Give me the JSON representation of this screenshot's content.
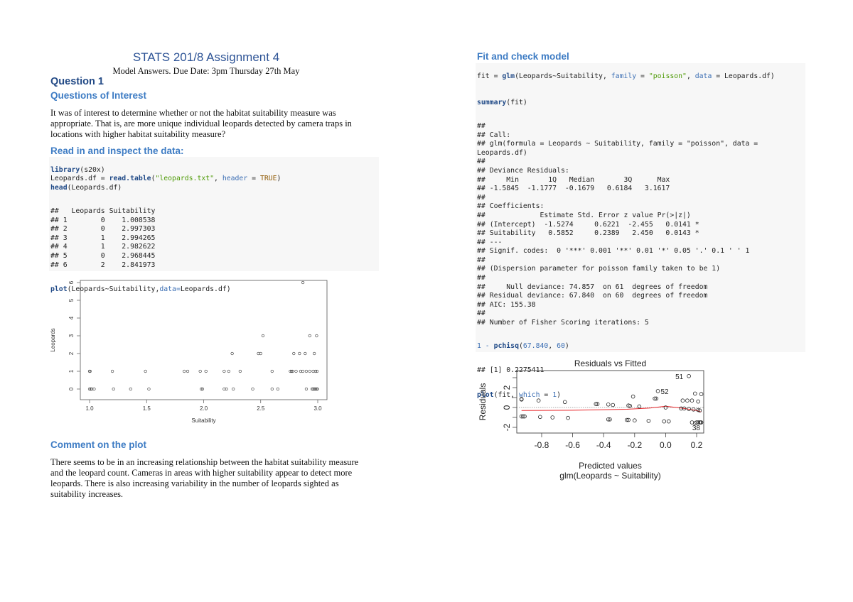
{
  "left": {
    "title": "STATS 201/8 Assignment 4",
    "subtitle": "Model Answers. Due Date: 3pm Thursday 27th May",
    "question": "Question 1",
    "questions_heading": "Questions of Interest",
    "intro_lines": [
      "It was of interest to determine whether or not the habitat suitability measure was",
      "appropriate. That is, are more unique individual leopards detected by camera traps in",
      "locations with higher habitat suitability measure?"
    ],
    "read_heading": "Read in and inspect the data:",
    "code1": {
      "line1_fn": "library",
      "line1_rest": "(s20x)",
      "line2_a": "Leopards.df = ",
      "line2_fn": "read.table",
      "line2_b": "(",
      "line2_str": "\"leopards.txt\"",
      "line2_c": ", ",
      "line2_arg": "header",
      "line2_d": " = ",
      "line2_bool": "TRUE",
      "line2_e": ")",
      "line3_fn": "head",
      "line3_rest": "(Leopards.df)"
    },
    "head_output": [
      "##   Leopards Suitability",
      "## 1        0    1.008538",
      "## 2        0    2.997303",
      "## 3        1    2.994265",
      "## 4        1    2.982622",
      "## 5        0    2.968445",
      "## 6        2    2.841973"
    ],
    "plot_code": {
      "fn": "plot",
      "a": "(Leopards~Suitability,",
      "arg": "data=",
      "b": "Leopards.df)"
    },
    "comment_heading": "Comment on the plot",
    "comment_lines": [
      "There seems to be in an increasing relationship between the habitat suitability measure",
      "and the leopard count. Cameras in areas with higher suitability appear to detect more",
      "leopards. There is also increasing variability in the number of leopards sighted as",
      "suitability increases."
    ]
  },
  "right": {
    "heading": "Fit and check model",
    "fit_code": {
      "a": "fit = ",
      "fn": "glm",
      "b": "(Leopards~Suitability, ",
      "arg1": "family",
      "c": " = ",
      "str": "\"poisson\"",
      "d": ", ",
      "arg2": "data",
      "e": " = Leopards.df)"
    },
    "summary_code": {
      "fn": "summary",
      "rest": "(fit)"
    },
    "summary_output": [
      "##",
      "## Call:",
      "## glm(formula = Leopards ~ Suitability, family = \"poisson\", data =",
      "Leopards.df)",
      "##",
      "## Deviance Residuals:",
      "##     Min       1Q   Median       3Q      Max",
      "## -1.5845  -1.1777  -0.1679   0.6184   3.1617",
      "##",
      "## Coefficients:",
      "##             Estimate Std. Error z value Pr(>|z|)",
      "## (Intercept)  -1.5274     0.6221  -2.455   0.0141 *",
      "## Suitability   0.5852     0.2389   2.450   0.0143 *",
      "## ---",
      "## Signif. codes:  0 '***' 0.001 '**' 0.01 '*' 0.05 '.' 0.1 ' ' 1",
      "##",
      "## (Dispersion parameter for poisson family taken to be 1)",
      "##",
      "##     Null deviance: 74.857  on 61  degrees of freedom",
      "## Residual deviance: 67.840  on 60  degrees of freedom",
      "## AIC: 155.38",
      "##",
      "## Number of Fisher Scoring iterations: 5"
    ],
    "pchisq_code": {
      "a": "1 - ",
      "fn": "pchisq",
      "b": "(",
      "n1": "67.840",
      "c": ", ",
      "n2": "60",
      "d": ")"
    },
    "pchisq_output": "## [1] 0.2275411",
    "plot_code": {
      "fn": "plot",
      "a": "(fit, ",
      "arg": "which",
      "b": " = ",
      "num": "1",
      "c": ")"
    }
  },
  "chart_data": [
    {
      "type": "scatter",
      "title": "",
      "xlabel": "Suitability",
      "ylabel": "Leopards",
      "xlim": [
        1.0,
        3.0
      ],
      "ylim": [
        0,
        6
      ],
      "xticks": [
        "1.0",
        "1.5",
        "2.0",
        "2.5",
        "3.0"
      ],
      "yticks": [
        "0",
        "1",
        "2",
        "3",
        "4",
        "5",
        "6"
      ],
      "grid": false,
      "points": [
        [
          1.0,
          0
        ],
        [
          1.01,
          0
        ],
        [
          1.02,
          0
        ],
        [
          1.04,
          0
        ],
        [
          1.21,
          0
        ],
        [
          1.36,
          0
        ],
        [
          1.52,
          0
        ],
        [
          1.98,
          0
        ],
        [
          1.99,
          0
        ],
        [
          2.18,
          0
        ],
        [
          2.2,
          0
        ],
        [
          2.26,
          0
        ],
        [
          2.43,
          0
        ],
        [
          2.6,
          0
        ],
        [
          2.65,
          0
        ],
        [
          2.9,
          0
        ],
        [
          2.95,
          0
        ],
        [
          2.96,
          0
        ],
        [
          2.97,
          0
        ],
        [
          2.98,
          0
        ],
        [
          2.99,
          0
        ],
        [
          2.997,
          0
        ],
        [
          1.0,
          1
        ],
        [
          1.005,
          1
        ],
        [
          1.2,
          1
        ],
        [
          1.49,
          1
        ],
        [
          1.83,
          1
        ],
        [
          1.86,
          1
        ],
        [
          1.97,
          1
        ],
        [
          2.02,
          1
        ],
        [
          2.18,
          1
        ],
        [
          2.22,
          1
        ],
        [
          2.32,
          1
        ],
        [
          2.6,
          1
        ],
        [
          2.76,
          1
        ],
        [
          2.77,
          1
        ],
        [
          2.78,
          1
        ],
        [
          2.81,
          1
        ],
        [
          2.85,
          1
        ],
        [
          2.87,
          1
        ],
        [
          2.9,
          1
        ],
        [
          2.93,
          1
        ],
        [
          2.96,
          1
        ],
        [
          2.98,
          1
        ],
        [
          2.994,
          1
        ],
        [
          2.25,
          2
        ],
        [
          2.48,
          2
        ],
        [
          2.5,
          2
        ],
        [
          2.79,
          2
        ],
        [
          2.84,
          2
        ],
        [
          2.89,
          2
        ],
        [
          2.97,
          2
        ],
        [
          2.52,
          3
        ],
        [
          2.93,
          3
        ],
        [
          2.99,
          3
        ],
        [
          2.87,
          6
        ]
      ]
    },
    {
      "type": "scatter",
      "title": "Residuals vs Fitted",
      "xlabel": "Predicted values",
      "xlabel2": "glm(Leopards ~ Suitability)",
      "ylabel": "Residuals",
      "xlim": [
        -0.95,
        0.25
      ],
      "ylim": [
        -2.2,
        3.4
      ],
      "xticks": [
        "-0.8",
        "-0.6",
        "-0.4",
        "-0.2",
        "0.0",
        "0.2"
      ],
      "yticks": [
        "-2",
        "0",
        "2"
      ],
      "grid": false,
      "labels": [
        {
          "text": "51",
          "x": 0.15,
          "y": 3.16
        },
        {
          "text": "52",
          "x": -0.05,
          "y": 1.65
        },
        {
          "text": "38",
          "x": 0.19,
          "y": -1.58
        }
      ],
      "points": [
        [
          -0.93,
          0.85
        ],
        [
          -0.93,
          0.8
        ],
        [
          -0.82,
          0.7
        ],
        [
          -0.65,
          0.55
        ],
        [
          -0.45,
          0.35
        ],
        [
          -0.44,
          0.35
        ],
        [
          -0.37,
          0.3
        ],
        [
          -0.34,
          0.25
        ],
        [
          -0.24,
          0.2
        ],
        [
          -0.23,
          0.15
        ],
        [
          -0.21,
          1.1
        ],
        [
          -0.17,
          0.1
        ],
        [
          -0.07,
          0.9
        ],
        [
          -0.06,
          0.9
        ],
        [
          -0.05,
          1.65
        ],
        [
          0.0,
          0.0
        ],
        [
          0.1,
          -0.1
        ],
        [
          0.11,
          0.7
        ],
        [
          0.12,
          -0.1
        ],
        [
          0.14,
          0.7
        ],
        [
          0.15,
          -0.15
        ],
        [
          0.15,
          3.16
        ],
        [
          0.17,
          0.7
        ],
        [
          0.18,
          -0.2
        ],
        [
          0.19,
          1.4
        ],
        [
          0.21,
          -0.25
        ],
        [
          0.21,
          0.6
        ],
        [
          0.22,
          -0.3
        ],
        [
          0.23,
          1.35
        ],
        [
          -0.93,
          -0.9
        ],
        [
          -0.92,
          -0.9
        ],
        [
          -0.91,
          -0.9
        ],
        [
          -0.81,
          -0.95
        ],
        [
          -0.73,
          -1.0
        ],
        [
          -0.63,
          -1.05
        ],
        [
          -0.37,
          -1.2
        ],
        [
          -0.36,
          -1.2
        ],
        [
          -0.25,
          -1.25
        ],
        [
          -0.24,
          -1.25
        ],
        [
          -0.2,
          -1.3
        ],
        [
          -0.11,
          -1.35
        ],
        [
          -0.01,
          -1.4
        ],
        [
          0.02,
          -1.4
        ],
        [
          0.17,
          -1.5
        ],
        [
          0.19,
          -1.58
        ],
        [
          0.2,
          -1.5
        ],
        [
          0.21,
          -1.5
        ],
        [
          0.22,
          -1.5
        ],
        [
          0.225,
          -1.5
        ],
        [
          0.23,
          -1.5
        ]
      ],
      "smooth": [
        [
          -0.93,
          -0.3
        ],
        [
          -0.6,
          -0.28
        ],
        [
          -0.4,
          -0.22
        ],
        [
          -0.25,
          -0.18
        ],
        [
          -0.1,
          -0.05
        ],
        [
          0.0,
          0.12
        ],
        [
          0.1,
          -0.05
        ],
        [
          0.2,
          -0.3
        ],
        [
          0.23,
          -0.45
        ]
      ],
      "smooth_color": "#e8262a"
    }
  ]
}
